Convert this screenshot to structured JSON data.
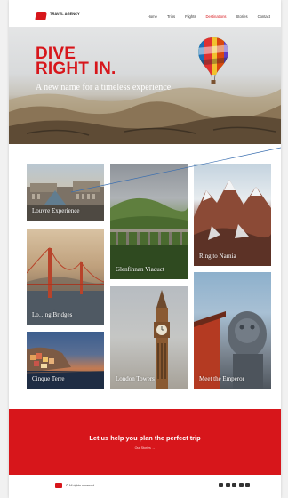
{
  "brand": {
    "name": "TRAVEL AGENCY"
  },
  "nav": {
    "items": [
      {
        "label": "Home",
        "active": false
      },
      {
        "label": "Trips",
        "active": false
      },
      {
        "label": "Flights",
        "active": false
      },
      {
        "label": "Destinations",
        "active": true
      },
      {
        "label": "Stories",
        "active": false
      },
      {
        "label": "Contact",
        "active": false
      }
    ]
  },
  "hero": {
    "title_line1": "DIVE",
    "title_line2": "RIGHT IN.",
    "subtitle": "A new name for a timeless experience."
  },
  "destinations": [
    {
      "id": "louvre",
      "label": "Louvre Experience"
    },
    {
      "id": "golden-gate",
      "label": "Lo…ng Bridges"
    },
    {
      "id": "cinque",
      "label": "Cinque Terre"
    },
    {
      "id": "glenfinnan",
      "label": "Glenfinnan Viaduct"
    },
    {
      "id": "london",
      "label": "London Towers"
    },
    {
      "id": "ring",
      "label": "Ring to Narnia"
    },
    {
      "id": "emperor",
      "label": "Meet the Emperor"
    }
  ],
  "cta": {
    "title": "Let us help you plan the perfect trip",
    "link_label": "Our Stories   →"
  },
  "footer": {
    "copyright": "© All rights reserved",
    "socials": [
      "linkedin-icon",
      "facebook-icon",
      "twitter-icon",
      "instagram-icon",
      "youtube-icon"
    ]
  },
  "colors": {
    "accent": "#d7161b",
    "background": "#ffffff"
  }
}
